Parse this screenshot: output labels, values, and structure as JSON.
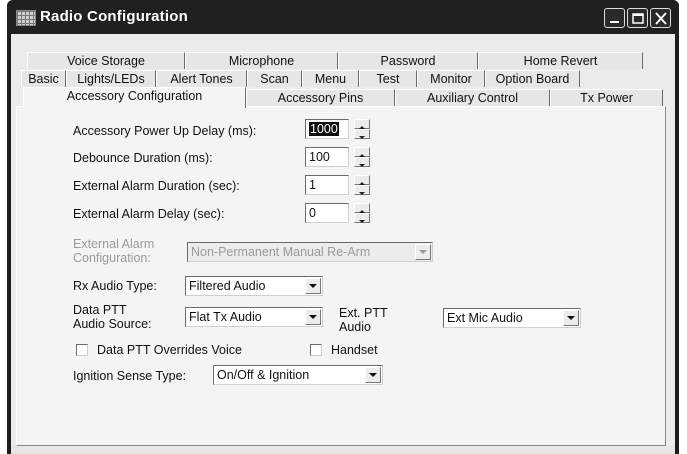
{
  "window": {
    "title": "Radio Configuration",
    "buttons": [
      "minimize",
      "maximize",
      "close"
    ]
  },
  "tabs": {
    "row1": [
      "Voice Storage",
      "Microphone",
      "Password",
      "Home Revert"
    ],
    "row2": [
      "Basic",
      "Lights/LEDs",
      "Alert Tones",
      "Scan",
      "Menu",
      "Test",
      "Monitor",
      "Option Board"
    ],
    "row3": [
      "Accessory Configuration",
      "Accessory Pins",
      "Auxiliary Control",
      "Tx Power"
    ],
    "active": "Accessory Configuration"
  },
  "form": {
    "power_up_delay": {
      "label": "Accessory Power Up Delay (ms):",
      "value": "1000"
    },
    "debounce": {
      "label": "Debounce Duration (ms):",
      "value": "100"
    },
    "alarm_duration": {
      "label": "External Alarm Duration (sec):",
      "value": "1"
    },
    "alarm_delay": {
      "label": "External Alarm Delay (sec):",
      "value": "0"
    },
    "alarm_config": {
      "label_line1": "External Alarm",
      "label_line2": "Configuration:",
      "value": "Non-Permanent Manual Re-Arm",
      "disabled": true
    },
    "rx_audio": {
      "label": "Rx Audio Type:",
      "value": "Filtered Audio"
    },
    "data_ptt_source": {
      "label_line1": "Data PTT",
      "label_line2": "Audio Source:",
      "value": "Flat Tx Audio"
    },
    "ext_ptt_audio": {
      "label_line1": "Ext. PTT",
      "label_line2": "Audio",
      "value": "Ext Mic Audio"
    },
    "data_ptt_overrides": {
      "label": "Data PTT Overrides Voice",
      "checked": false
    },
    "handset": {
      "label": "Handset",
      "checked": false
    },
    "ignition_sense": {
      "label": "Ignition Sense Type:",
      "value": "On/Off & Ignition"
    }
  }
}
